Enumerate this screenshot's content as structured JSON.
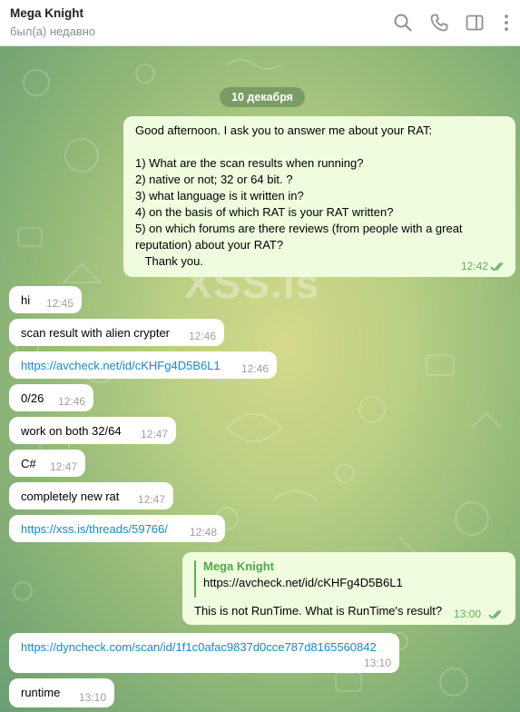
{
  "header": {
    "title": "Mega Knight",
    "status": "был(а) недавно"
  },
  "chat": {
    "date_label": "10 декабря",
    "watermark": "XSS.is",
    "first_message": {
      "text": "Good afternoon. I ask you to answer me about your RAT:\n\n1) What are the scan results when running?\n2) native or not; 32 or 64 bit. ?\n3) what language is it written in?\n4) on the basis of which RAT is your RAT written?\n5) on which forums are there reviews (from people with a great\nreputation) about your RAT?\n   Thank you.",
      "time": "12:42"
    },
    "incoming": [
      {
        "text": "hi",
        "time": "12:45",
        "link": false
      },
      {
        "text": "scan result with alien crypter",
        "time": "12:46",
        "link": false
      },
      {
        "text": "https://avcheck.net/id/cKHFg4D5B6L1",
        "time": "12:46",
        "link": true
      },
      {
        "text": "0/26",
        "time": "12:46",
        "link": false
      },
      {
        "text": "work on both 32/64",
        "time": "12:47",
        "link": false
      },
      {
        "text": "C#",
        "time": "12:47",
        "link": false
      },
      {
        "text": "completely new rat",
        "time": "12:47",
        "link": false
      },
      {
        "text": "https://xss.is/threads/59766/",
        "time": "12:48",
        "link": true
      }
    ],
    "reply_message": {
      "quote_author": "Mega Knight",
      "quote_text": "https://avcheck.net/id/cKHFg4D5B6L1",
      "text": "This is not RunTime. What is RunTime's result?",
      "time": "13:00"
    },
    "incoming_2": [
      {
        "text": "https://dyncheck.com/scan/id/1f1c0afac9837d0cce787d8165560842",
        "time": "13:10",
        "link": true
      },
      {
        "text": "runtime",
        "time": "13:10",
        "link": false
      }
    ]
  },
  "colors": {
    "header_bg": "#ffffff",
    "incoming_bubble": "#ffffff",
    "outgoing_bubble": "#effdde",
    "link": "#168acd",
    "accent_green": "#5fae58"
  },
  "icons": [
    "search-icon",
    "phone-icon",
    "sidebar-toggle-icon",
    "more-vertical-icon",
    "double-check-icon"
  ]
}
